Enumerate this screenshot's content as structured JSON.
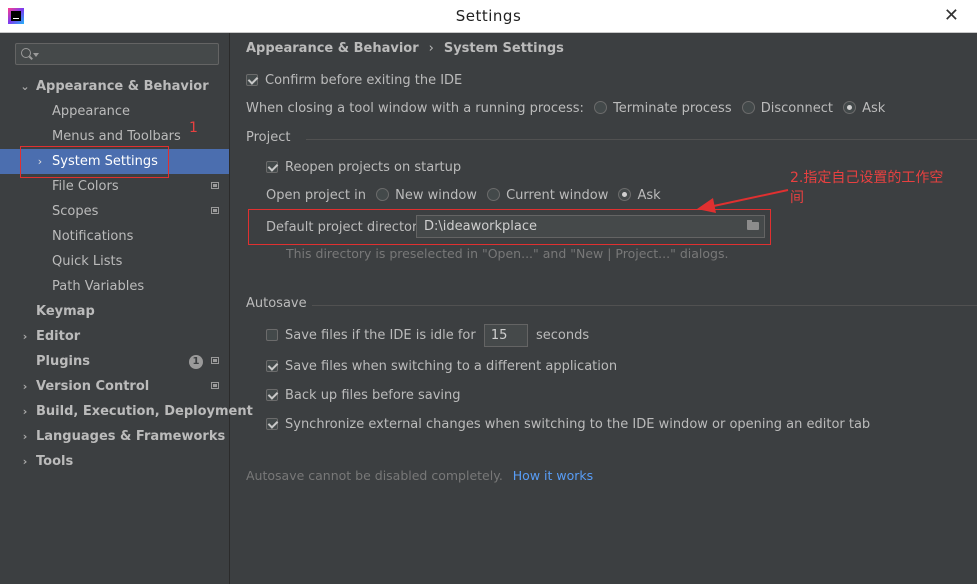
{
  "window": {
    "title": "Settings",
    "close_glyph": "✕"
  },
  "sidebar": {
    "search_placeholder": "",
    "items": [
      {
        "label": "Appearance & Behavior",
        "expanded": true
      },
      {
        "label": "Appearance"
      },
      {
        "label": "Menus and Toolbars"
      },
      {
        "label": "System Settings",
        "selected": true
      },
      {
        "label": "File Colors"
      },
      {
        "label": "Scopes"
      },
      {
        "label": "Notifications"
      },
      {
        "label": "Quick Lists"
      },
      {
        "label": "Path Variables"
      },
      {
        "label": "Keymap"
      },
      {
        "label": "Editor"
      },
      {
        "label": "Plugins",
        "badge": "1"
      },
      {
        "label": "Version Control"
      },
      {
        "label": "Build, Execution, Deployment"
      },
      {
        "label": "Languages & Frameworks"
      },
      {
        "label": "Tools"
      }
    ]
  },
  "breadcrumb": {
    "parent": "Appearance & Behavior",
    "separator": "›",
    "current": "System Settings"
  },
  "general": {
    "confirm_exit_label": "Confirm before exiting the IDE",
    "confirm_exit_checked": true,
    "closing_label": "When closing a tool window with a running process:",
    "closing_options": [
      "Terminate process",
      "Disconnect",
      "Ask"
    ],
    "closing_selected": "Ask"
  },
  "project": {
    "section_title": "Project",
    "reopen_label": "Reopen projects on startup",
    "reopen_checked": true,
    "open_in_label": "Open project in",
    "open_options": [
      "New window",
      "Current window",
      "Ask"
    ],
    "open_selected": "Ask",
    "default_dir_label": "Default project directory:",
    "default_dir_value": "D:\\ideaworkplace",
    "hint": "This directory is preselected in \"Open...\" and \"New | Project...\" dialogs."
  },
  "autosave": {
    "section_title": "Autosave",
    "idle_label": "Save files if the IDE is idle for",
    "idle_value": "15",
    "idle_unit": "seconds",
    "idle_checked": false,
    "switch_label": "Save files when switching to a different application",
    "switch_checked": true,
    "backup_label": "Back up files before saving",
    "backup_checked": true,
    "sync_label": "Synchronize external changes when switching to the IDE window or opening an editor tab",
    "sync_checked": true
  },
  "footer": {
    "note": "Autosave cannot be disabled completely.",
    "link": "How it works"
  },
  "annotations": {
    "marker_1": "1",
    "marker_2_line1": "2.指定自己设置的工作空",
    "marker_2_line2": "间",
    "color": "#e03030"
  },
  "colors": {
    "background": "#3c3f41",
    "selection": "#4b6eaf",
    "link": "#589df6",
    "text": "#bbbbbb"
  }
}
